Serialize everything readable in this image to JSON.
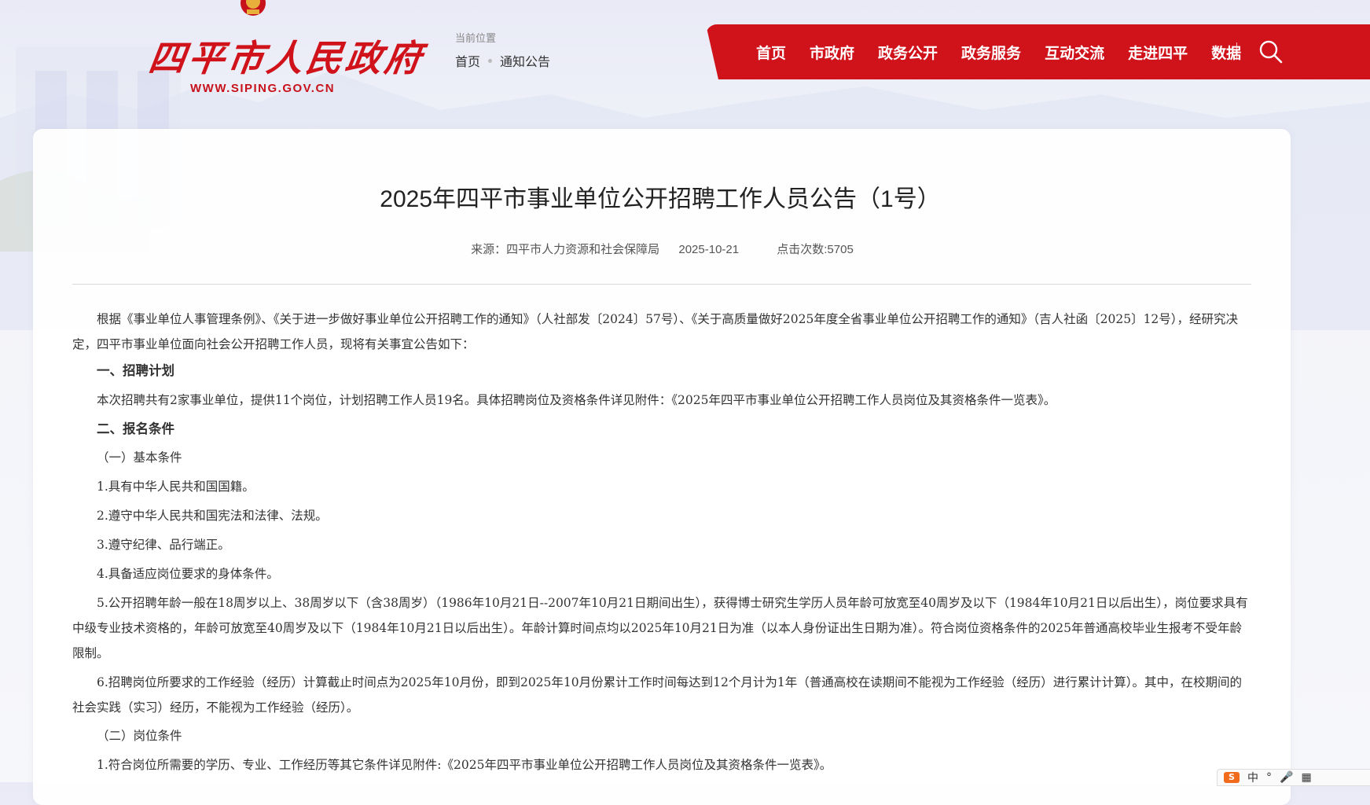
{
  "header": {
    "logo_text": "四平市人民政府",
    "logo_url": "WWW.SIPING.GOV.CN",
    "breadcrumb_title": "当前位置",
    "breadcrumb": [
      "首页",
      "通知公告"
    ]
  },
  "nav": {
    "items": [
      "首页",
      "市政府",
      "政务公开",
      "政务服务",
      "互动交流",
      "走进四平",
      "数据"
    ]
  },
  "article": {
    "title": "2025年四平市事业单位公开招聘工作人员公告（1号）",
    "source": "来源：四平市人力资源和社会保障局",
    "date": "2025-10-21",
    "clicks": "点击次数:5705",
    "paragraphs": [
      "根据《事业单位人事管理条例》、《关于进一步做好事业单位公开招聘工作的通知》（人社部发〔2024〕57号）、《关于高质量做好2025年度全省事业单位公开招聘工作的通知》（吉人社函〔2025〕12号），经研究决定，四平市事业单位面向社会公开招聘工作人员，现将有关事宜公告如下：",
      "一、招聘计划",
      "本次招聘共有2家事业单位，提供11个岗位，计划招聘工作人员19名。具体招聘岗位及资格条件详见附件：《2025年四平市事业单位公开招聘工作人员岗位及其资格条件一览表》。",
      "二、报名条件",
      "（一）基本条件",
      "1.具有中华人民共和国国籍。",
      "2.遵守中华人民共和国宪法和法律、法规。",
      "3.遵守纪律、品行端正。",
      "4.具备适应岗位要求的身体条件。",
      "5.公开招聘年龄一般在18周岁以上、38周岁以下（含38周岁）（1986年10月21日--2007年10月21日期间出生），获得博士研究生学历人员年龄可放宽至40周岁及以下（1984年10月21日以后出生），岗位要求具有中级专业技术资格的，年龄可放宽至40周岁及以下（1984年10月21日以后出生）。年龄计算时间点均以2025年10月21日为准（以本人身份证出生日期为准）。符合岗位资格条件的2025年普通高校毕业生报考不受年龄限制。",
      "6.招聘岗位所要求的工作经验（经历）计算截止时间点为2025年10月份，即到2025年10月份累计工作时间每达到12个月计为1年（普通高校在读期间不能视为工作经验（经历）进行累计计算）。其中，在校期间的社会实践（实习）经历，不能视为工作经验（经历）。",
      "（二）岗位条件",
      "1.符合岗位所需要的学历、专业、工作经历等其它条件详见附件:《2025年四平市事业单位公开招聘工作人员岗位及其资格条件一览表》。"
    ]
  },
  "ime": {
    "lang": "中"
  },
  "colors": {
    "brand_red": "#d0121b"
  }
}
